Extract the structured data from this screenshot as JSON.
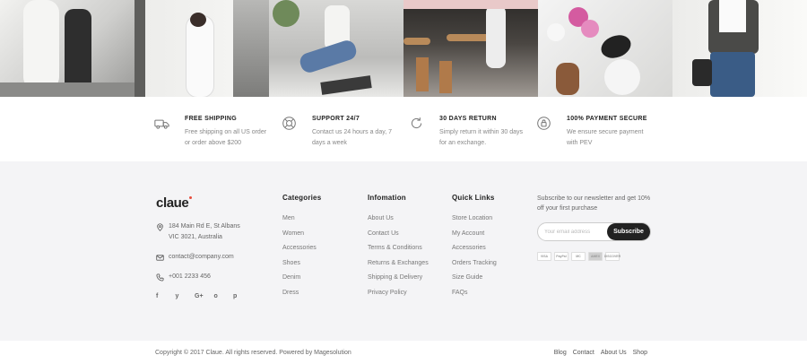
{
  "instagram": {
    "tiles": [
      {
        "name": "instagram-photo-1",
        "bg": "#d9d9d7",
        "accent": "#3a3a3a"
      },
      {
        "name": "instagram-photo-2",
        "bg": "#e2e2e0",
        "accent": "#2b2b2b"
      },
      {
        "name": "instagram-photo-3",
        "bg": "#c4c4c2",
        "accent": "#5a7aa6"
      },
      {
        "name": "instagram-photo-4",
        "bg": "#3e3a36",
        "accent": "#b07a4a"
      },
      {
        "name": "instagram-photo-5",
        "bg": "#d6d6d4",
        "accent": "#d45ba0"
      },
      {
        "name": "instagram-photo-6",
        "bg": "#e0e0de",
        "accent": "#3a5c86"
      }
    ]
  },
  "services": [
    {
      "title": "FREE SHIPPING",
      "desc": "Free shipping on all US order or order above $200",
      "icon": "truck-icon"
    },
    {
      "title": "SUPPORT 24/7",
      "desc": "Contact us 24 hours a day, 7 days a week",
      "icon": "lifebuoy-icon"
    },
    {
      "title": "30 DAYS RETURN",
      "desc": "Simply return it within 30 days for an exchange.",
      "icon": "return-icon"
    },
    {
      "title": "100% PAYMENT SECURE",
      "desc": "We ensure secure payment with PEV",
      "icon": "lock-icon"
    }
  ],
  "brand": {
    "logo": "claue",
    "address": "184 Main Rd E, St Albans VIC 3021, Australia",
    "email": "contact@company.com",
    "phone": "+001 2233 456",
    "socials": [
      "f",
      "y",
      "G+",
      "o",
      "p"
    ]
  },
  "categories": {
    "title": "Categories",
    "items": [
      "Men",
      "Women",
      "Accessories",
      "Shoes",
      "Denim",
      "Dress"
    ]
  },
  "information": {
    "title": "Infomation",
    "items": [
      "About Us",
      "Contact Us",
      "Terms & Conditions",
      "Returns & Exchanges",
      "Shipping & Delivery",
      "Privacy Policy"
    ]
  },
  "quick_links": {
    "title": "Quick Links",
    "items": [
      "Store Location",
      "My Account",
      "Accessories",
      "Orders Tracking",
      "Size Guide",
      "FAQs"
    ]
  },
  "newsletter": {
    "text": "Subscribe to our newsletter and get 10% off your first purchase",
    "placeholder": "Your email address",
    "button": "Subscribe",
    "cards": [
      "VISA",
      "PayPal",
      "MC",
      "AMEX",
      "DISCOVER"
    ]
  },
  "bottom": {
    "copyright": "Copyright © 2017 Claue. All rights reserved. Powered by Magesolution",
    "links": [
      "Blog",
      "Contact",
      "About Us",
      "Shop"
    ]
  },
  "colors": {
    "footer_bg": "#f4f4f6",
    "accent": "#e74c3c",
    "dark": "#222222"
  }
}
